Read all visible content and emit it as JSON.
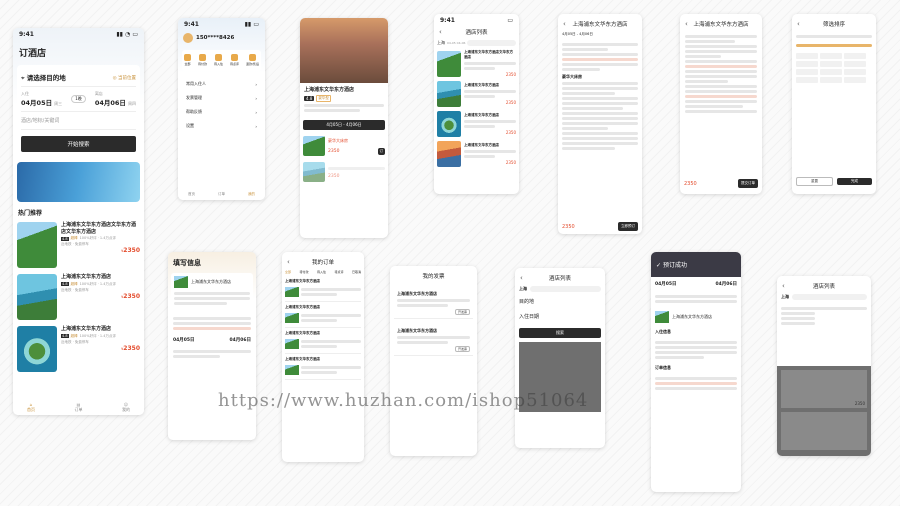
{
  "watermark": "https://www.huzhan.com/ishop51064",
  "p1": {
    "time": "9:41",
    "title": "订酒店",
    "location": "请选择目的地",
    "mylocation": "当前位置",
    "checkin_lbl": "入住",
    "checkout_lbl": "离店",
    "checkin": "04月05日",
    "checkin_day": "周三",
    "nights": "1晚",
    "checkout": "04月06日",
    "checkout_day": "周四",
    "search_ph": "酒店/地标/关键词",
    "search_btn": "开始搜索",
    "section": "热门推荐",
    "hotels": [
      {
        "name": "上海浦东文华东方酒店文华东方酒店文华东方酒店",
        "type": "豪华型",
        "score": "4.8",
        "score_lbl": "超棒",
        "reviews": "100%好评 · 1.4万点评",
        "feature": "近地铁 · 免费停车",
        "price": "2350"
      },
      {
        "name": "上海浦东文华东方酒店",
        "type": "豪华型",
        "score": "4.8",
        "score_lbl": "超棒",
        "reviews": "100%好评 · 1.4万点评",
        "feature": "近地铁 · 免费停车",
        "price": "2350"
      },
      {
        "name": "上海浦东文华东方酒店",
        "type": "豪华型",
        "score": "4.8",
        "score_lbl": "超棒",
        "reviews": "100%好评 · 1.4万点评",
        "feature": "近地铁 · 免费停车",
        "price": "2350"
      }
    ],
    "tabs": [
      "首页",
      "订单",
      "我的"
    ]
  },
  "p2": {
    "phone": "150****8426",
    "icons": [
      "全部",
      "待付款",
      "待入住",
      "待点评",
      "退款/售后"
    ],
    "menu": [
      "常用入住人",
      "发票管理",
      "帮助反馈",
      "设置"
    ],
    "tabs": [
      "首页",
      "订单",
      "我的"
    ]
  },
  "p3": {
    "name": "上海浦东文华东方酒店",
    "score": "4.8",
    "tags": "豪华型",
    "date": "4月05日 - 4月06日",
    "room": "豪华大床房",
    "price": "2350",
    "price2": "2350"
  },
  "p4": {
    "title": "酒店列表",
    "city": "上海",
    "date": "04-05 04-06",
    "items": [
      {
        "name": "上海浦东文华东方酒店文华东方酒店",
        "price": "2350"
      },
      {
        "name": "上海浦东文华东方酒店",
        "price": "2350"
      },
      {
        "name": "上海浦东文华东方酒店",
        "price": "2350"
      },
      {
        "name": "上海浦东文华东方酒店",
        "price": "2350"
      }
    ]
  },
  "p5": {
    "title": "上海浦东文华东方酒店",
    "date": "4月05日 - 4月06日",
    "room": "豪华大床房",
    "price": "2350",
    "btn": "立即预订"
  },
  "p6": {
    "title": "上海浦东文华东方酒店",
    "price": "2350",
    "btn": "提交订单"
  },
  "p7": {
    "title": "筛选排序",
    "cancel": "重置",
    "ok": "完成"
  },
  "p8": {
    "title": "填写信息",
    "hotel": "上海浦东文华东方酒店",
    "checkin": "04月05日",
    "checkout": "04月06日"
  },
  "p9": {
    "title": "我的订单",
    "tabs": [
      "全部",
      "待付款",
      "待入住",
      "待点评",
      "已取消"
    ],
    "orders": [
      "上海浦东文华东方酒店",
      "上海浦东文华东方酒店",
      "上海浦东文华东方酒店",
      "上海浦东文华东方酒店"
    ]
  },
  "p10": {
    "title": "我的发票",
    "items": [
      "上海浦东文华东方酒店",
      "上海浦东文华东方酒店"
    ],
    "btn": "开发票"
  },
  "p11": {
    "title": "酒店列表",
    "city": "上海",
    "sub": "目的地",
    "people": "入住日期",
    "btn": "搜索"
  },
  "p12": {
    "title": "预订成功",
    "date1": "04月05日",
    "date2": "04月06日",
    "hotel": "上海浦东文华东方酒店",
    "sect1": "入住信息",
    "sect2": "订单信息"
  },
  "p13": {
    "title": "酒店列表",
    "city": "上海",
    "price": "2350"
  }
}
